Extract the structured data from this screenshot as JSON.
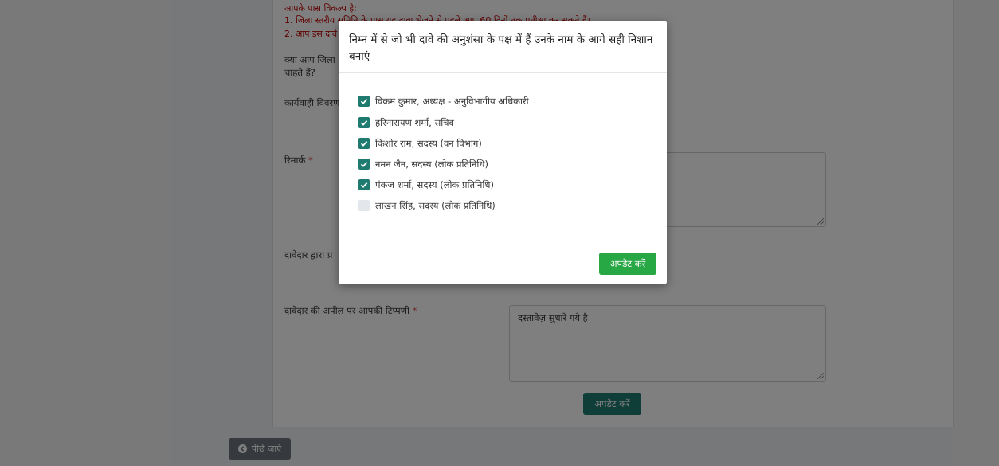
{
  "background": {
    "notice_heading": "आपके पास विकल्प है:",
    "notice_line1": "1. जिला स्तरीय समिति के पास यह दावा भेजने से पहले आप 60 दिनों तक प्रतीक्षा कर सकते हैं।",
    "notice_line2": "2. आप इस दावे",
    "question_line1": "क्या आप जिला",
    "question_line2": "चाहते हैं?",
    "proceedings_label": "कार्यवाही विवरण",
    "remark_label": "रिमार्क",
    "claimant_label": "दावेदार द्वारा प्र",
    "appeal_label": "दावेदार की अपील पर आपकी टिप्पणी",
    "required_mark": "*",
    "appeal_value": "दस्तावेज़ सुधारे गये है।",
    "update_button": "अपडेट करें",
    "back_button": "पीछे जाएं"
  },
  "modal": {
    "title": "निम्न में से जो भी दावे की अनुशंसा के पक्ष में हैं उनके नाम के आगे सही निशान बनाएं",
    "options": [
      {
        "label": "विक्रम कुमार, अध्यक्ष - अनुविभागीय अधिकारी",
        "checked": true
      },
      {
        "label": "हरिनारायण शर्मा, सचिव",
        "checked": true
      },
      {
        "label": "किशोर राम, सदस्य (वन विभाग)",
        "checked": true
      },
      {
        "label": "नमन जैन, सदस्य (लोक प्रतिनिधि)",
        "checked": true
      },
      {
        "label": "पंकज शर्मा, सदस्य (लोक प्रतिनिधि)",
        "checked": true
      },
      {
        "label": "लाखन सिंह, सदस्य (लोक प्रतिनिधि)",
        "checked": false
      }
    ],
    "update_button": "अपडेट करें"
  },
  "colors": {
    "accent_teal": "#1f7a6f",
    "primary_green": "#28a745",
    "warning_red": "#c00000",
    "back_grey": "#6c757d"
  }
}
